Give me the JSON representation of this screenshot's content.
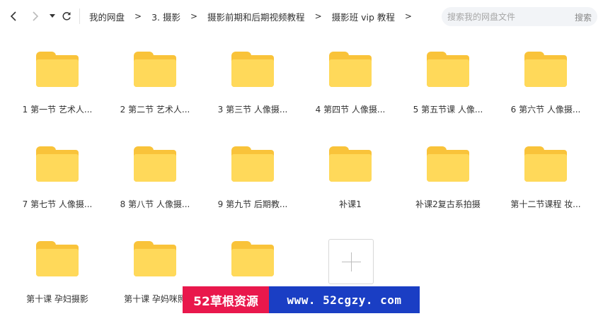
{
  "toolbar": {
    "back_icon": "chevron-left-icon",
    "forward_icon": "chevron-right-icon",
    "history_icon": "caret-down-icon",
    "refresh_icon": "refresh-icon",
    "breadcrumb": [
      "我的网盘",
      "3. 摄影",
      "摄影前期和后期视频教程",
      "摄影班 vip  教程"
    ],
    "breadcrumb_sep": ">",
    "search_placeholder": "搜索我的网盘文件",
    "search_value": "",
    "search_label": "搜索"
  },
  "folders": [
    {
      "name": "1 第一节 艺术人..."
    },
    {
      "name": "2 第二节 艺术人..."
    },
    {
      "name": "3 第三节 人像摄..."
    },
    {
      "name": "4 第四节 人像摄..."
    },
    {
      "name": "5 第五节课  人像..."
    },
    {
      "name": "6 第六节  人像摄..."
    },
    {
      "name": "7 第七节  人像摄..."
    },
    {
      "name": "8 第八节 人像摄..."
    },
    {
      "name": "9 第九节  后期教..."
    },
    {
      "name": "补课1"
    },
    {
      "name": "补课2复古系拍摄"
    },
    {
      "name": "第十二节课程 妆..."
    },
    {
      "name": "第十课 孕妇摄影"
    },
    {
      "name": "第十课 孕妈咪照"
    },
    {
      "name": ""
    }
  ],
  "add_tile_icon": "plus-icon",
  "watermark": {
    "left_text": "52草根资源",
    "right_text": "www. 52cgzy. com",
    "left_color": "#e9184c",
    "right_color": "#1a3ec4"
  },
  "colors": {
    "folder_back": "#f9c33a",
    "folder_front": "#ffd95a"
  }
}
